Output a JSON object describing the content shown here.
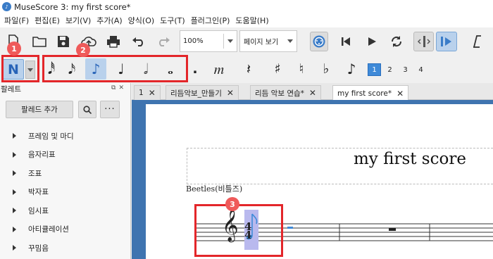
{
  "window": {
    "title": "MuseScore 3: my first score*",
    "app_icon": "musescore-icon"
  },
  "menu": [
    "파일(F)",
    "편집(E)",
    "보기(V)",
    "추가(A)",
    "양식(O)",
    "도구(T)",
    "플러그인(P)",
    "도움말(H)"
  ],
  "toolbar": {
    "zoom": "100%",
    "view_mode": "페이지 보기",
    "icons": [
      "new-file-icon",
      "open-folder-icon",
      "save-icon",
      "cloud-upload-icon",
      "print-icon",
      "undo-icon",
      "redo-icon",
      "midi-input-icon",
      "rewind-icon",
      "play-icon",
      "loop-icon",
      "metronome-icon",
      "pan-icon",
      "score-info-icon"
    ]
  },
  "note_input": {
    "mode_glyph": "N",
    "durations": [
      "64분음표",
      "32분음표",
      "16분음표",
      "8분음표",
      "4분음표",
      "2분음표",
      "온음표"
    ],
    "selected_duration": "8분음표",
    "glyphs": [
      "𝅘𝅥𝅰",
      "𝅘𝅥𝅯",
      "♪",
      "♩",
      "𝅗𝅥",
      "𝅝",
      ".",
      "𝆐",
      "𝄽",
      "♯",
      "♮",
      "♭",
      "♪"
    ],
    "voices": [
      "1",
      "2",
      "3",
      "4"
    ],
    "active_voice": "1"
  },
  "markers": [
    "1",
    "2",
    "3"
  ],
  "palette": {
    "title": "팔레트",
    "add_button": "팔레드 추가",
    "more": "···",
    "items": [
      "프레임 및 마디",
      "음자리표",
      "조표",
      "박자표",
      "임시표",
      "아티큘레이션",
      "꾸밈음"
    ]
  },
  "tabs": [
    {
      "label": "1",
      "active": false
    },
    {
      "label": "리듬악보_만들기",
      "active": false
    },
    {
      "label": "리듬 악보 연습*",
      "active": false
    },
    {
      "label": "my first score*",
      "active": true
    }
  ],
  "score": {
    "title": "my first score",
    "composer": "Beetles(비틀즈)",
    "time_sig_top": "4",
    "time_sig_bottom": "4"
  },
  "colors": {
    "accent_red": "#e3262a",
    "marker_red": "#ef5a5a",
    "selection_blue": "#b9d1ec",
    "score_bg": "#3f74b0",
    "note_blue": "#3f8ad8"
  }
}
